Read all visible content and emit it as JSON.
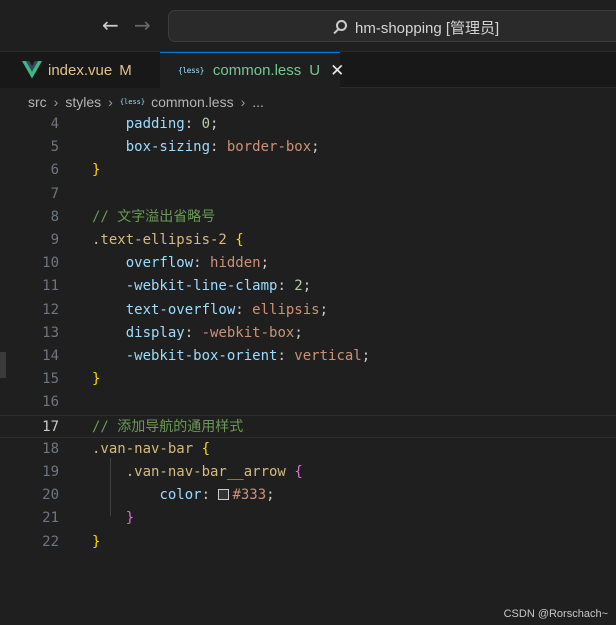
{
  "titlebar": {
    "back_arrow": "←",
    "forward_arrow": "→",
    "search_text": "hm-shopping [管理员]"
  },
  "tabs": [
    {
      "name": "index.vue",
      "status": "M",
      "icon": "vue-icon"
    },
    {
      "name": "common.less",
      "status": "U",
      "icon": "less-icon",
      "close": "✕"
    }
  ],
  "breadcrumb": {
    "items": [
      "src",
      "styles",
      "common.less",
      "..."
    ],
    "separator": "›"
  },
  "editor": {
    "active_line": 17,
    "swatch_color": "#333333",
    "lines": [
      {
        "num": "4",
        "text": "    padding: 0;"
      },
      {
        "num": "5",
        "text": "    box-sizing: border-box;"
      },
      {
        "num": "6",
        "text": "}"
      },
      {
        "num": "7",
        "text": ""
      },
      {
        "num": "8",
        "text": "// 文字溢出省略号"
      },
      {
        "num": "9",
        "text": ".text-ellipsis-2 {"
      },
      {
        "num": "10",
        "text": "    overflow: hidden;"
      },
      {
        "num": "11",
        "text": "    -webkit-line-clamp: 2;"
      },
      {
        "num": "12",
        "text": "    text-overflow: ellipsis;"
      },
      {
        "num": "13",
        "text": "    display: -webkit-box;"
      },
      {
        "num": "14",
        "text": "    -webkit-box-orient: vertical;"
      },
      {
        "num": "15",
        "text": "}"
      },
      {
        "num": "16",
        "text": ""
      },
      {
        "num": "17",
        "text": "// 添加导航的通用样式"
      },
      {
        "num": "18",
        "text": ".van-nav-bar {"
      },
      {
        "num": "19",
        "text": "    .van-nav-bar__arrow {"
      },
      {
        "num": "20",
        "text": "        color: #333;"
      },
      {
        "num": "21",
        "text": "    }"
      },
      {
        "num": "22",
        "text": "}"
      }
    ]
  },
  "watermark": "CSDN @Rorschach~",
  "colors": {
    "background": "#1f1f1f",
    "property": "#9cdcfe",
    "value": "#ce9178",
    "number": "#b5cea8",
    "selector": "#d7ba7d",
    "comment": "#6a9955",
    "brace_level1": "#ffd700",
    "brace_level2": "#da70d6",
    "modified": "#e2c08d",
    "untracked": "#73c991"
  }
}
